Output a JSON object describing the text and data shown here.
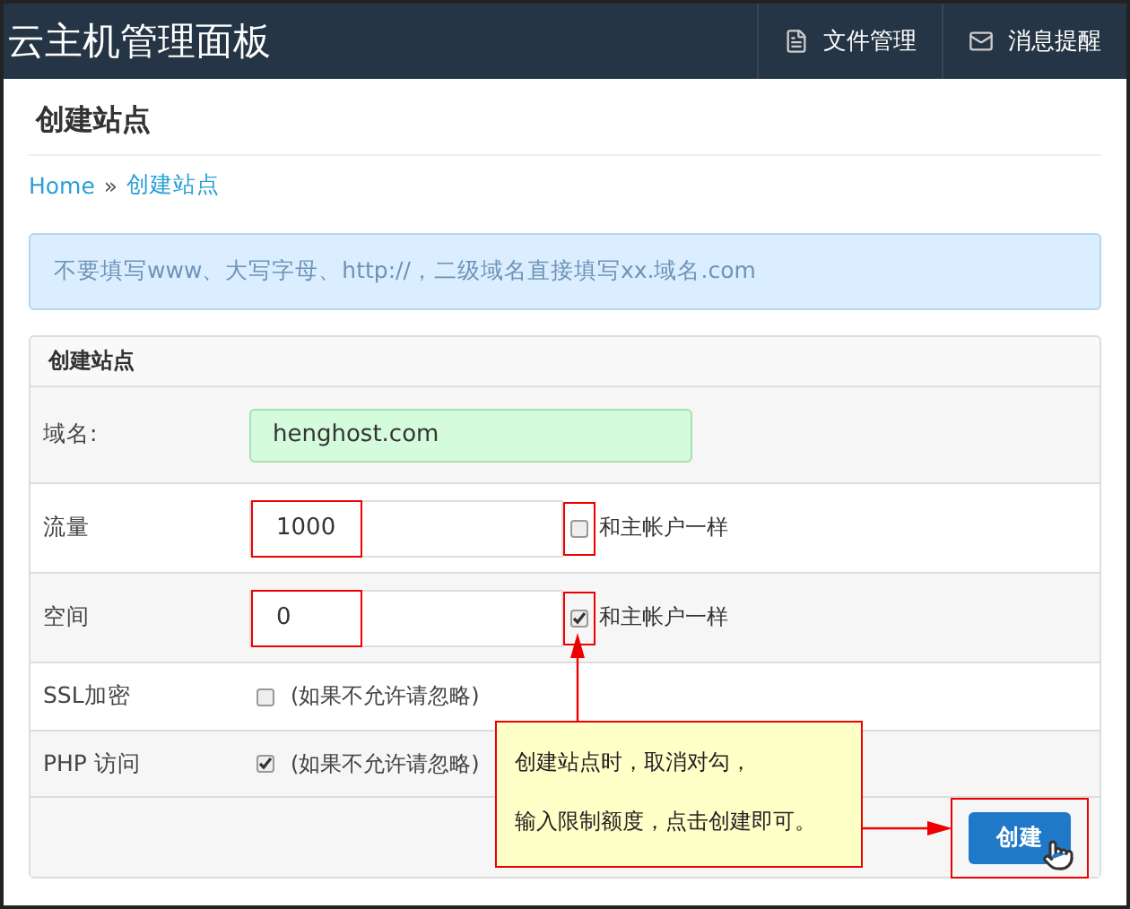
{
  "navbar": {
    "brand": "云主机管理面板",
    "items": [
      {
        "kind": "file",
        "label": "文件管理"
      },
      {
        "kind": "mail",
        "label": "消息提醒"
      }
    ]
  },
  "page_title": "创建站点",
  "breadcrumb": [
    {
      "label": "Home"
    },
    {
      "label": "创建站点"
    }
  ],
  "breadcrumb_separator": "»",
  "alert": "不要填写www、大写字母、http://，二级域名直接填写xx.域名.com",
  "panel": {
    "title": "创建站点",
    "fields": [
      {
        "kind": "text",
        "label": "域名:",
        "value": "henghost.com"
      },
      {
        "kind": "quota",
        "label": "流量",
        "value": "1000",
        "highlighted": true,
        "same_as_main": {
          "label": "和主帐户一样",
          "checked": false
        }
      },
      {
        "kind": "quota",
        "label": "空间",
        "value": "0",
        "highlighted": true,
        "same_as_main": {
          "label": "和主帐户一样",
          "checked": true
        }
      },
      {
        "kind": "check",
        "label": "SSL加密",
        "checked": false,
        "hint": "(如果不允许请忽略)"
      },
      {
        "kind": "check",
        "label": "PHP 访问",
        "checked": true,
        "hint": "(如果不允许请忽略)"
      }
    ],
    "submit": {
      "label": "创建",
      "highlighted": true
    }
  },
  "annotation": {
    "lines": [
      "创建站点时，取消对勾，",
      "输入限制额度，点击创建即可。"
    ]
  }
}
